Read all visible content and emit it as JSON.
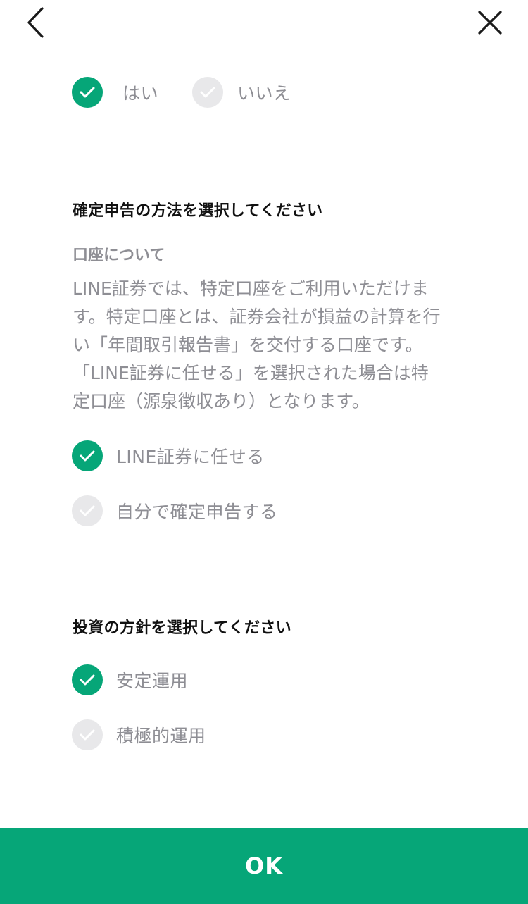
{
  "header": {
    "back_icon": "chevron-left-icon",
    "close_icon": "close-icon"
  },
  "colors": {
    "accent": "#06a678",
    "unchecked": "#e8e8ea",
    "muted_text": "#8e8e94",
    "heading_text": "#111111"
  },
  "question1": {
    "options": [
      {
        "label": "はい",
        "selected": true
      },
      {
        "label": "いいえ",
        "selected": false
      }
    ]
  },
  "tax_filing": {
    "title": "確定申告の方法を選択してください",
    "account_heading": "口座について",
    "description_lines": [
      "LINE証券では、特定口座をご利用いただけま",
      "す。特定口座とは、証券会社が損益の計算を行",
      "い「年間取引報告書」を交付する口座です。",
      "「LINE証券に任せる」を選択された場合は特",
      "定口座（源泉徴収あり）となります。"
    ],
    "options": [
      {
        "label": "LINE証券に任せる",
        "selected": true
      },
      {
        "label": "自分で確定申告する",
        "selected": false
      }
    ]
  },
  "investment_policy": {
    "title": "投資の方針を選択してください",
    "options": [
      {
        "label": "安定運用",
        "selected": true
      },
      {
        "label": "積極的運用",
        "selected": false
      }
    ]
  },
  "footer": {
    "ok_label": "OK"
  }
}
